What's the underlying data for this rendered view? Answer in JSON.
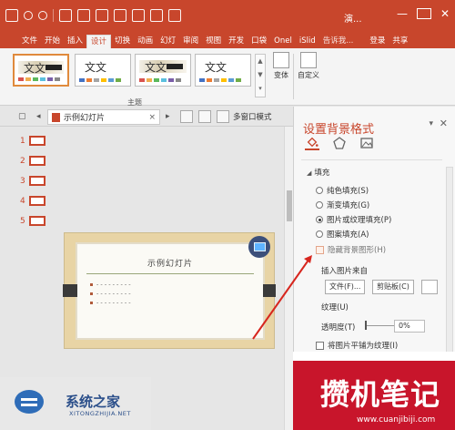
{
  "window": {
    "title": "演..."
  },
  "tabs": [
    {
      "label": "文件"
    },
    {
      "label": "开始"
    },
    {
      "label": "插入"
    },
    {
      "label": "设计"
    },
    {
      "label": "切换"
    },
    {
      "label": "动画"
    },
    {
      "label": "幻灯"
    },
    {
      "label": "审阅"
    },
    {
      "label": "视图"
    },
    {
      "label": "开发"
    },
    {
      "label": "口袋"
    },
    {
      "label": "Onel"
    },
    {
      "label": "iSlid"
    },
    {
      "label": "告诉我..."
    },
    {
      "label": "登录"
    },
    {
      "label": "共享"
    }
  ],
  "ribbon": {
    "themes": [
      {
        "label": "文文"
      },
      {
        "label": "文文"
      },
      {
        "label": "文文"
      },
      {
        "label": "文文"
      }
    ],
    "variant_label": "变体",
    "customize_label": "自定义",
    "group_label": "主题"
  },
  "docbar": {
    "tab_title": "示例幻灯片",
    "close": "×",
    "multi_window": "多窗口模式"
  },
  "thumbnails": [
    "1",
    "2",
    "3",
    "4",
    "5"
  ],
  "slide": {
    "title": "示例幻灯片",
    "bullets": [
      "- - - - - - - - -",
      "- - - - - - - - -",
      "- - - - - - - - -"
    ]
  },
  "pane": {
    "title": "设置背景格式",
    "section": "填充",
    "options": [
      {
        "label": "纯色填充(S)",
        "selected": false
      },
      {
        "label": "渐变填充(G)",
        "selected": false
      },
      {
        "label": "图片或纹理填充(P)",
        "selected": true
      },
      {
        "label": "图案填充(A)",
        "selected": false
      }
    ],
    "hide_bg_label": "隐藏背景图形(H)",
    "insert_from": "插入图片来自",
    "file_button": "文件(F)...",
    "clipboard_button": "剪贴板(C)",
    "texture_label": "纹理(U)",
    "transparency_label": "透明度(T)",
    "transparency_value": "0%",
    "tile_label": "将图片平铺为纹理(I)"
  },
  "watermarks": {
    "left_name": "系统之家",
    "left_site": "XITONGZHIJIA.NET",
    "right_name": "攒机笔记",
    "right_site": "www.cuanjibiji.com"
  },
  "colors": {
    "accent": "#c8462c",
    "selected_theme_border": "#e08a3c"
  }
}
